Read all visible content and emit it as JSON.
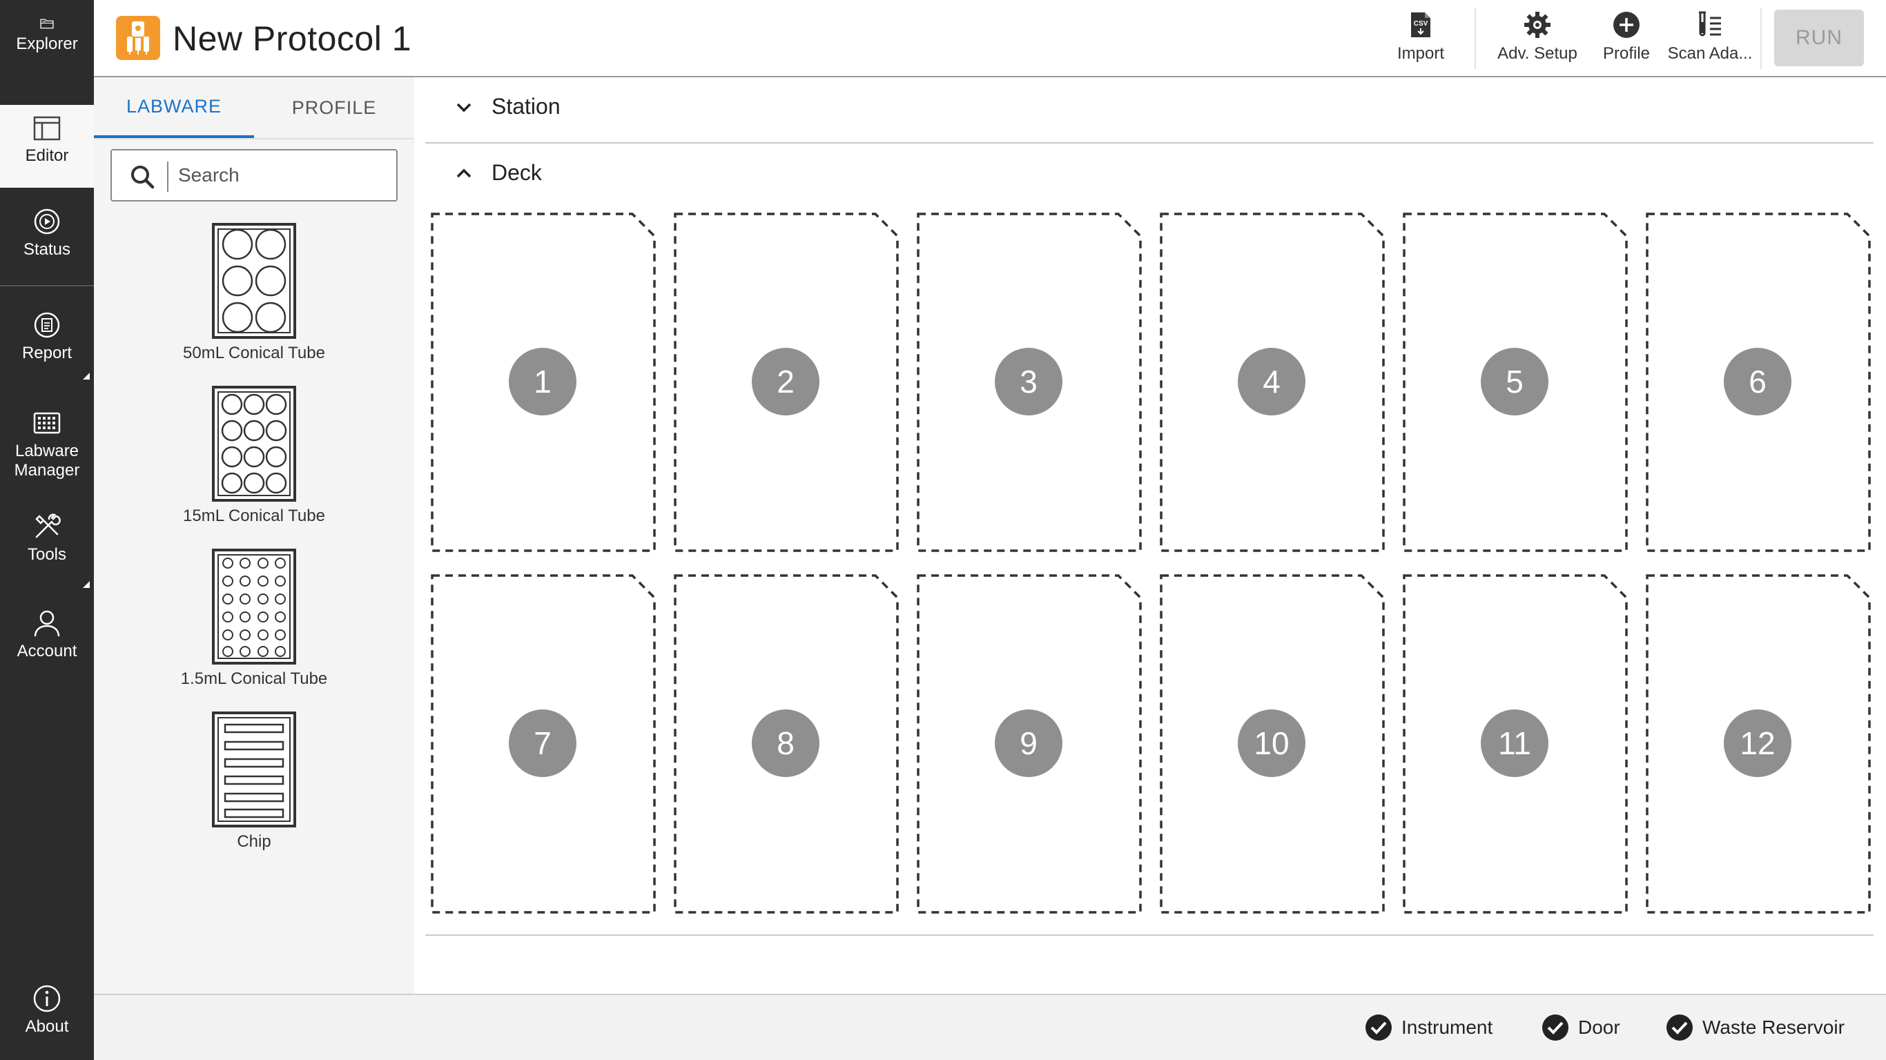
{
  "nav": {
    "items": [
      {
        "label": "Explorer",
        "icon": "folder-icon"
      },
      {
        "label": "Editor",
        "icon": "editor-icon"
      },
      {
        "label": "Status",
        "icon": "play-circle-icon"
      },
      {
        "label": "Report",
        "icon": "report-icon"
      },
      {
        "label": "Labware Manager",
        "icon": "grid-icon"
      },
      {
        "label": "Tools",
        "icon": "tools-icon"
      },
      {
        "label": "Account",
        "icon": "user-icon"
      },
      {
        "label": "About",
        "icon": "info-icon"
      }
    ],
    "active": "Editor"
  },
  "header": {
    "title": "New Protocol 1",
    "tools": [
      {
        "label": "Import",
        "icon": "csv-file-icon"
      },
      {
        "label": "Adv. Setup",
        "icon": "gear-icon"
      },
      {
        "label": "Profile",
        "icon": "plus-circle-icon"
      },
      {
        "label": "Scan Ada...",
        "icon": "tube-list-icon"
      }
    ],
    "run_label": "RUN"
  },
  "panel": {
    "tabs": [
      "LABWARE",
      "PROFILE"
    ],
    "active_tab": "LABWARE",
    "search_placeholder": "Search",
    "labware": [
      {
        "label": "50mL Conical Tube"
      },
      {
        "label": "15mL Conical Tube"
      },
      {
        "label": "1.5mL Conical Tube"
      },
      {
        "label": "Chip"
      }
    ]
  },
  "main": {
    "station_label": "Station",
    "deck_label": "Deck",
    "slots": [
      "1",
      "2",
      "3",
      "4",
      "5",
      "6",
      "7",
      "8",
      "9",
      "10",
      "11",
      "12"
    ]
  },
  "status": {
    "items": [
      "Instrument",
      "Door",
      "Waste Reservoir"
    ]
  },
  "colors": {
    "nav_bg": "#2c2c2c",
    "accent": "#1a73c7",
    "logo": "#f49a2c",
    "slot_badge": "#8f8f8f"
  }
}
